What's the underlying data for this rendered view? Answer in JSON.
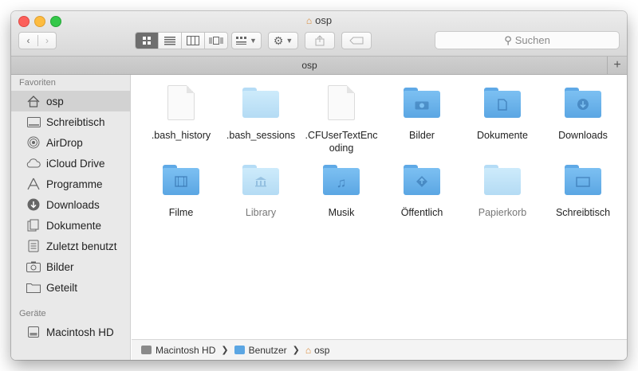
{
  "window": {
    "title": "osp"
  },
  "toolbar": {
    "view_modes": [
      "icon-view",
      "list-view",
      "column-view",
      "cover-flow-view"
    ],
    "active_view": "icon-view",
    "search_placeholder": "Suchen"
  },
  "tab": {
    "label": "osp",
    "add": "+"
  },
  "sidebar": {
    "favorites_header": "Favoriten",
    "favorites": [
      {
        "label": "osp",
        "icon": "home-icon",
        "selected": true
      },
      {
        "label": "Schreibtisch",
        "icon": "desktop-icon"
      },
      {
        "label": "AirDrop",
        "icon": "airdrop-icon"
      },
      {
        "label": "iCloud Drive",
        "icon": "cloud-icon"
      },
      {
        "label": "Programme",
        "icon": "applications-icon"
      },
      {
        "label": "Downloads",
        "icon": "download-icon"
      },
      {
        "label": "Dokumente",
        "icon": "documents-icon"
      },
      {
        "label": "Zuletzt benutzt",
        "icon": "recents-icon"
      },
      {
        "label": "Bilder",
        "icon": "camera-icon"
      },
      {
        "label": "Geteilt",
        "icon": "shared-folder-icon"
      }
    ],
    "devices_header": "Geräte",
    "devices": [
      {
        "label": "Macintosh HD",
        "icon": "harddisk-icon"
      }
    ]
  },
  "files": [
    {
      "label": ".bash_history",
      "kind": "document",
      "dim": false
    },
    {
      "label": ".bash_sessions",
      "kind": "folder-light",
      "dim": false
    },
    {
      "label": ".CFUserTextEnc\noding",
      "kind": "document",
      "dim": false
    },
    {
      "label": "Bilder",
      "kind": "folder",
      "glyph": "camera-icon"
    },
    {
      "label": "Dokumente",
      "kind": "folder",
      "glyph": "document-icon"
    },
    {
      "label": "Downloads",
      "kind": "folder",
      "glyph": "download-icon"
    },
    {
      "label": "Filme",
      "kind": "folder",
      "glyph": "film-icon"
    },
    {
      "label": "Library",
      "kind": "folder-light",
      "glyph": "library-icon",
      "dim": true
    },
    {
      "label": "Musik",
      "kind": "folder",
      "glyph": "music-icon"
    },
    {
      "label": "Öffentlich",
      "kind": "folder",
      "glyph": "public-icon"
    },
    {
      "label": "Papierkorb",
      "kind": "folder-light",
      "dim": true
    },
    {
      "label": "Schreibtisch",
      "kind": "folder",
      "glyph": "desktop-icon"
    }
  ],
  "pathbar": [
    "Macintosh HD",
    "Benutzer",
    "osp"
  ],
  "colors": {
    "folder_blue": "#5ba6e3",
    "folder_light": "#b4dbf4",
    "sidebar_bg": "#e9e9e9",
    "selected_bg": "#d2d2d2"
  }
}
